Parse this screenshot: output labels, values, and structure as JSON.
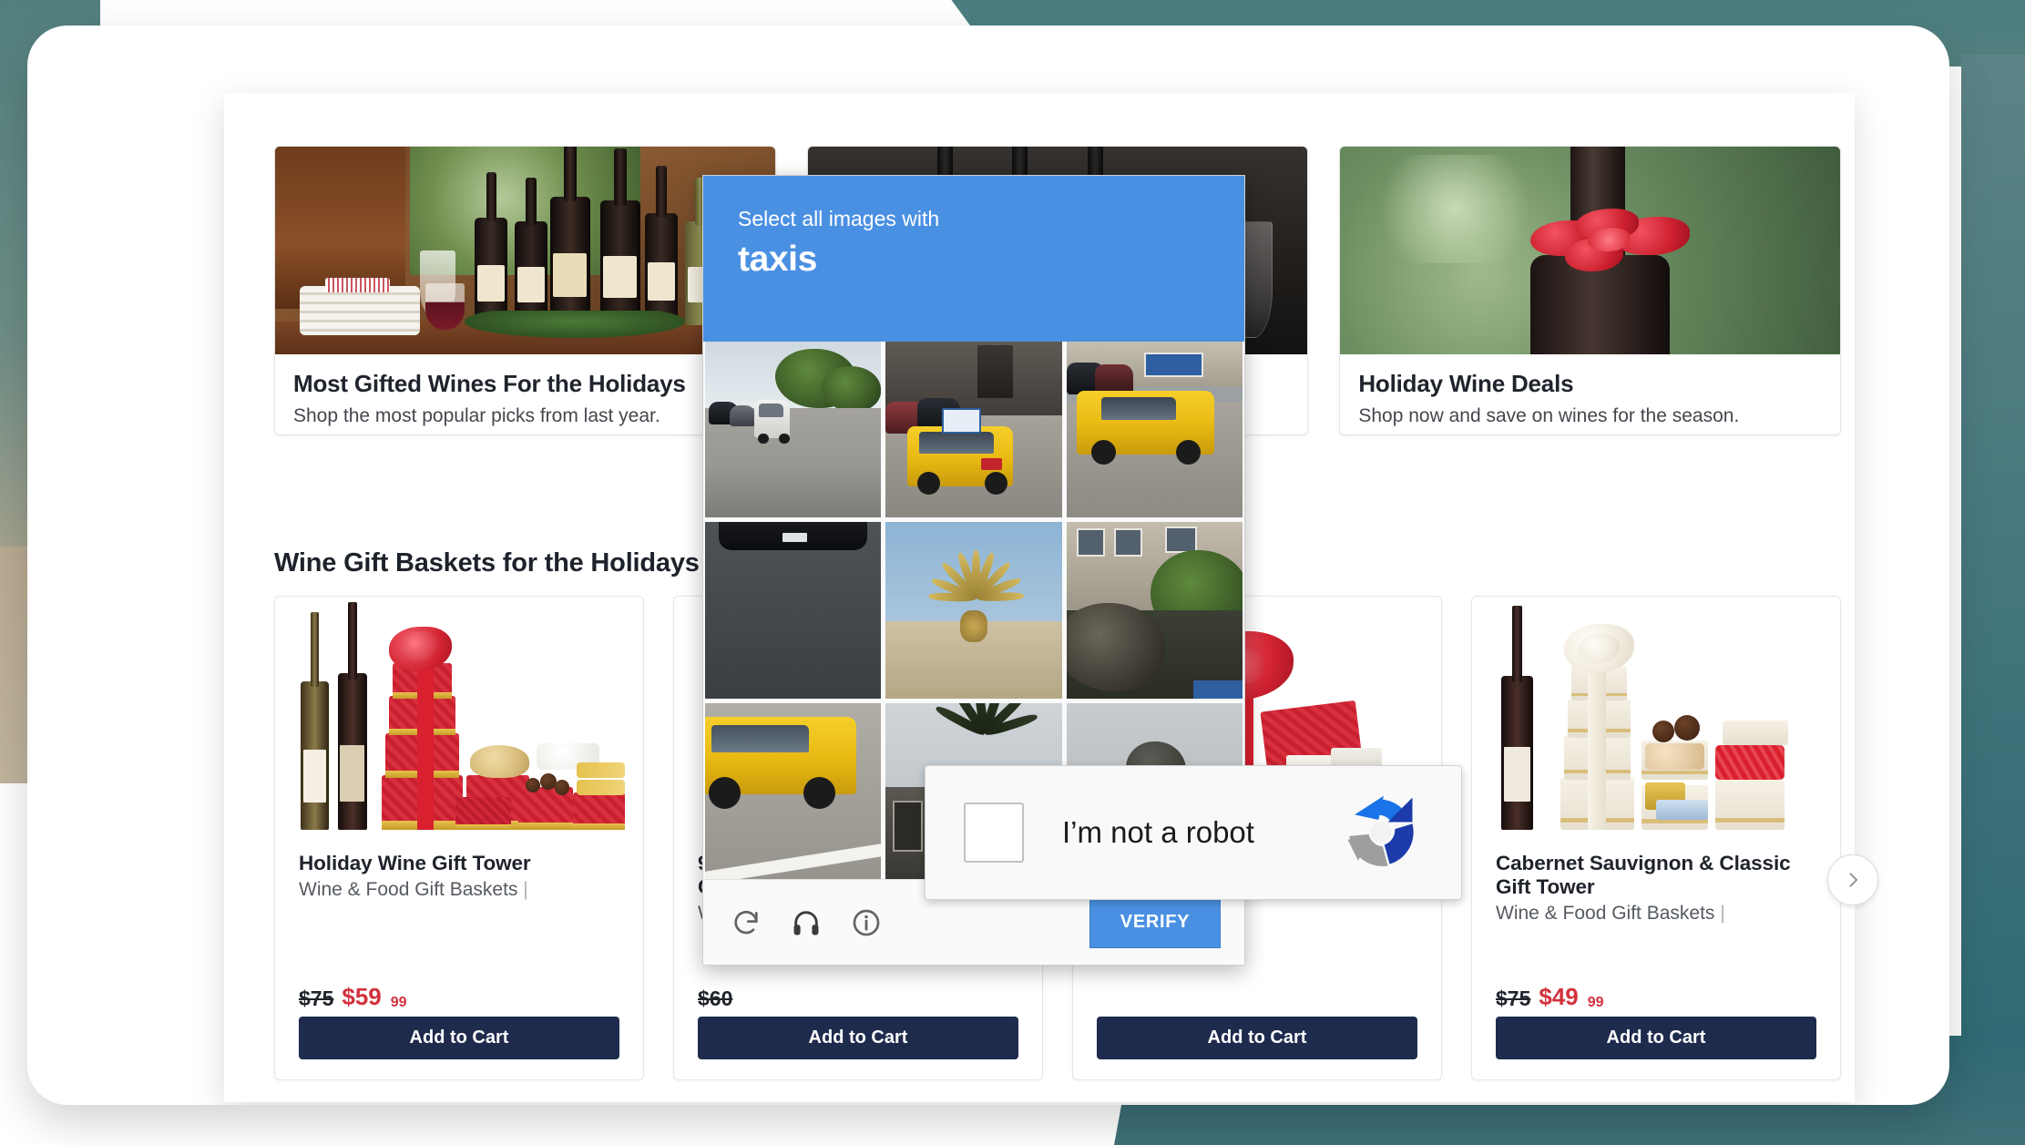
{
  "theme": {
    "accent_teal": "#4b7d80",
    "accent_tan": "#b9ab92",
    "brand_navy": "#1f2b4d",
    "price_red": "#d2323c",
    "captcha_blue": "#4a90e2"
  },
  "banners": [
    {
      "title": "Most Gifted Wines For the Holidays",
      "subtitle": "Shop the most popular picks from last year.",
      "image_alt": "holiday-table-with-wine-bottles"
    },
    {
      "title": "",
      "subtitle": "",
      "image_alt": "dark-wine-bottles-and-glasses"
    },
    {
      "title": "Holiday Wine Deals",
      "subtitle": "Shop now and save on wines for the season.",
      "image_alt": "wine-bottle-with-red-ribbon"
    }
  ],
  "section": {
    "heading": "Wine Gift Baskets for the Holidays"
  },
  "products": [
    {
      "title": "Holiday Wine Gift Tower",
      "category": "Wine & Food Gift Baskets",
      "category_separator": "|",
      "price_old": "$75",
      "price_new": "$59",
      "price_cents": "99",
      "cta": "Add to Cart",
      "image_alt": "red-gift-tower-with-two-wine-bottles"
    },
    {
      "title": "90 Point Wine & Gift Basket",
      "title_visible": "90",
      "title_visible_line2": "Gift",
      "category": "Wine & Food Gift Baskets",
      "category_visible": "Win",
      "category_separator": "|",
      "price_old": "$60",
      "price_old_visible": "$60",
      "price_new": "",
      "price_cents": "",
      "cta": "Add to Cart",
      "image_alt": "wine-gift-basket"
    },
    {
      "title": "",
      "category": "",
      "category_separator": "",
      "price_old": "",
      "price_new": "",
      "price_cents": "",
      "cta": "Add to Cart",
      "image_alt": "gourmet-gift-basket-with-red-bow"
    },
    {
      "title": "Cabernet Sauvignon & Classic Gift Tower",
      "category": "Wine & Food Gift Baskets",
      "category_separator": "|",
      "price_old": "$75",
      "price_new": "$49",
      "price_cents": "99",
      "cta": "Add to Cart",
      "image_alt": "cream-gift-tower-with-wine-bottle"
    }
  ],
  "carousel": {
    "next_icon": "chevron-right-icon"
  },
  "captcha": {
    "prompt": "Select all images with",
    "target": "taxis",
    "verify_label": "VERIFY",
    "icons": [
      {
        "name": "reload-icon",
        "label": "Get a new challenge"
      },
      {
        "name": "headphones-icon",
        "label": "Get an audio challenge"
      },
      {
        "name": "info-icon",
        "label": "More information"
      }
    ],
    "grid": [
      {
        "index": 1,
        "alt": "street-with-parked-cars-and-white-van",
        "selected": false
      },
      {
        "index": 2,
        "alt": "yellow-taxi-rear-on-city-street",
        "selected": false
      },
      {
        "index": 3,
        "alt": "yellow-taxi-side-view-in-parking-lot",
        "selected": false
      },
      {
        "index": 4,
        "alt": "dark-car-on-asphalt-road",
        "selected": false
      },
      {
        "index": 5,
        "alt": "palm-tree-on-sandy-hill",
        "selected": false
      },
      {
        "index": 6,
        "alt": "bushes-in-front-of-house",
        "selected": false
      },
      {
        "index": 7,
        "alt": "yellow-taxi-on-road-with-white-line",
        "selected": false
      },
      {
        "index": 8,
        "alt": "palm-plant-by-building",
        "selected": false
      },
      {
        "index": 9,
        "alt": "grey-pavement-scene",
        "selected": false
      }
    ]
  },
  "recaptcha": {
    "label": "I’m not a robot",
    "checked": false,
    "logo_name": "recaptcha-logo-icon"
  }
}
